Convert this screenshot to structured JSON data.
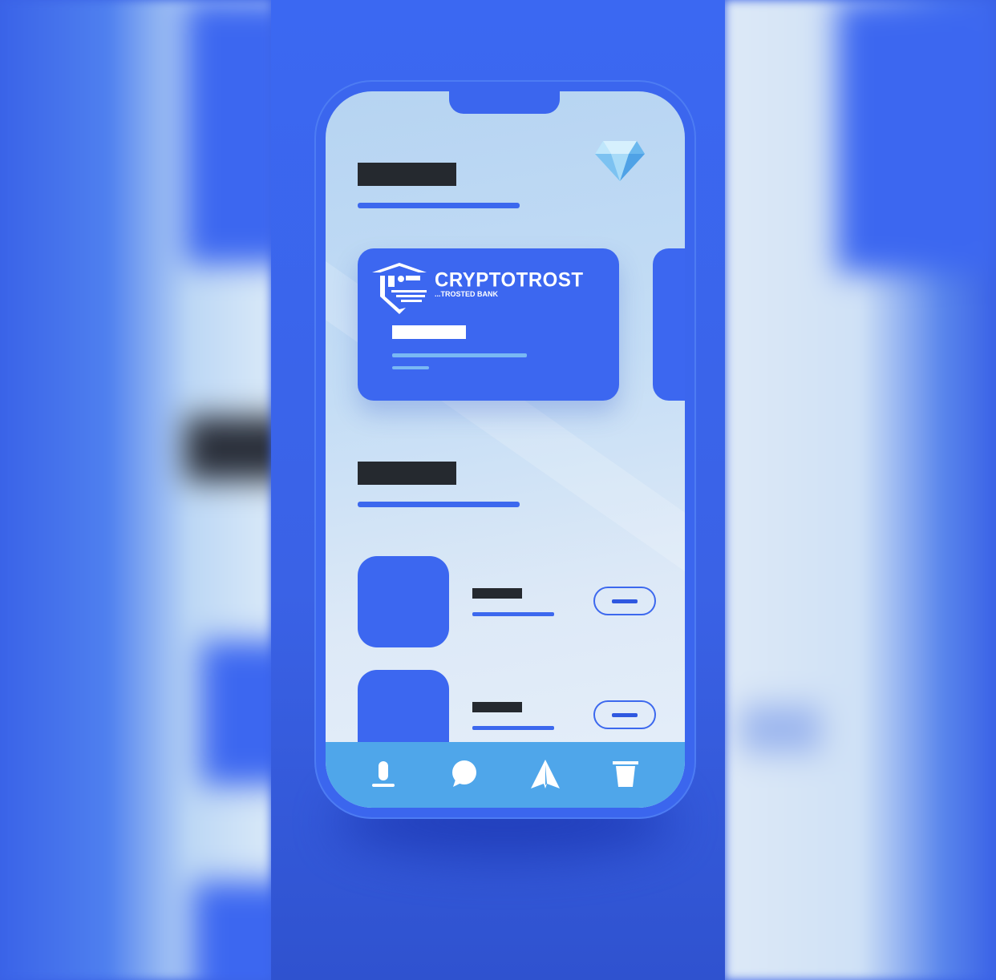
{
  "app": {
    "brand_name": "CRYPTOTROST",
    "tagline": "...TROSTED BANK"
  },
  "header": {
    "icon": "diamond-icon"
  },
  "tabbar": {
    "tabs": [
      {
        "icon": "mic-icon"
      },
      {
        "icon": "chat-icon"
      },
      {
        "icon": "send-icon"
      },
      {
        "icon": "trash-icon"
      }
    ]
  },
  "colors": {
    "accent": "#3c67f0",
    "tabbar": "#4fa6ea",
    "screen_bg": "#c4ddf5",
    "placeholder_dark": "#25292f"
  }
}
